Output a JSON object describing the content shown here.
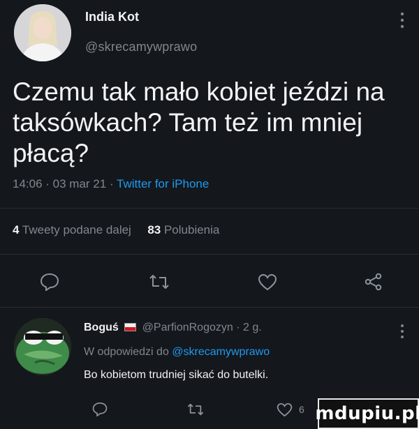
{
  "tweet": {
    "author_name": "India Kot",
    "author_handle": "@skrecamywprawo",
    "text": "Czemu tak mało kobiet jeździ na taksówkach? Tam też im mniej płacą?",
    "time": "14:06",
    "date": "03 mar 21",
    "client": "Twitter for iPhone",
    "retweet_count": "4",
    "retweet_label": "Tweety podane dalej",
    "like_count": "83",
    "like_label": "Polubienia"
  },
  "reply": {
    "author_name": "Boguś",
    "author_handle": "@ParfionRogozyn",
    "age": "2 g.",
    "in_reply_to_prefix": "W odpowiedzi do",
    "in_reply_to": "@skrecamywprawo",
    "text": "Bo kobietom trudniej sikać do butelki.",
    "like_count": "6"
  },
  "watermark": "mdupiu.pl",
  "icons": {
    "reply": "reply-icon",
    "retweet": "retweet-icon",
    "like": "heart-icon",
    "share": "share-icon",
    "more": "more-vertical-icon"
  },
  "colors": {
    "background": "#14171c",
    "link": "#1d9bf0",
    "secondary_text": "#7f8790"
  }
}
